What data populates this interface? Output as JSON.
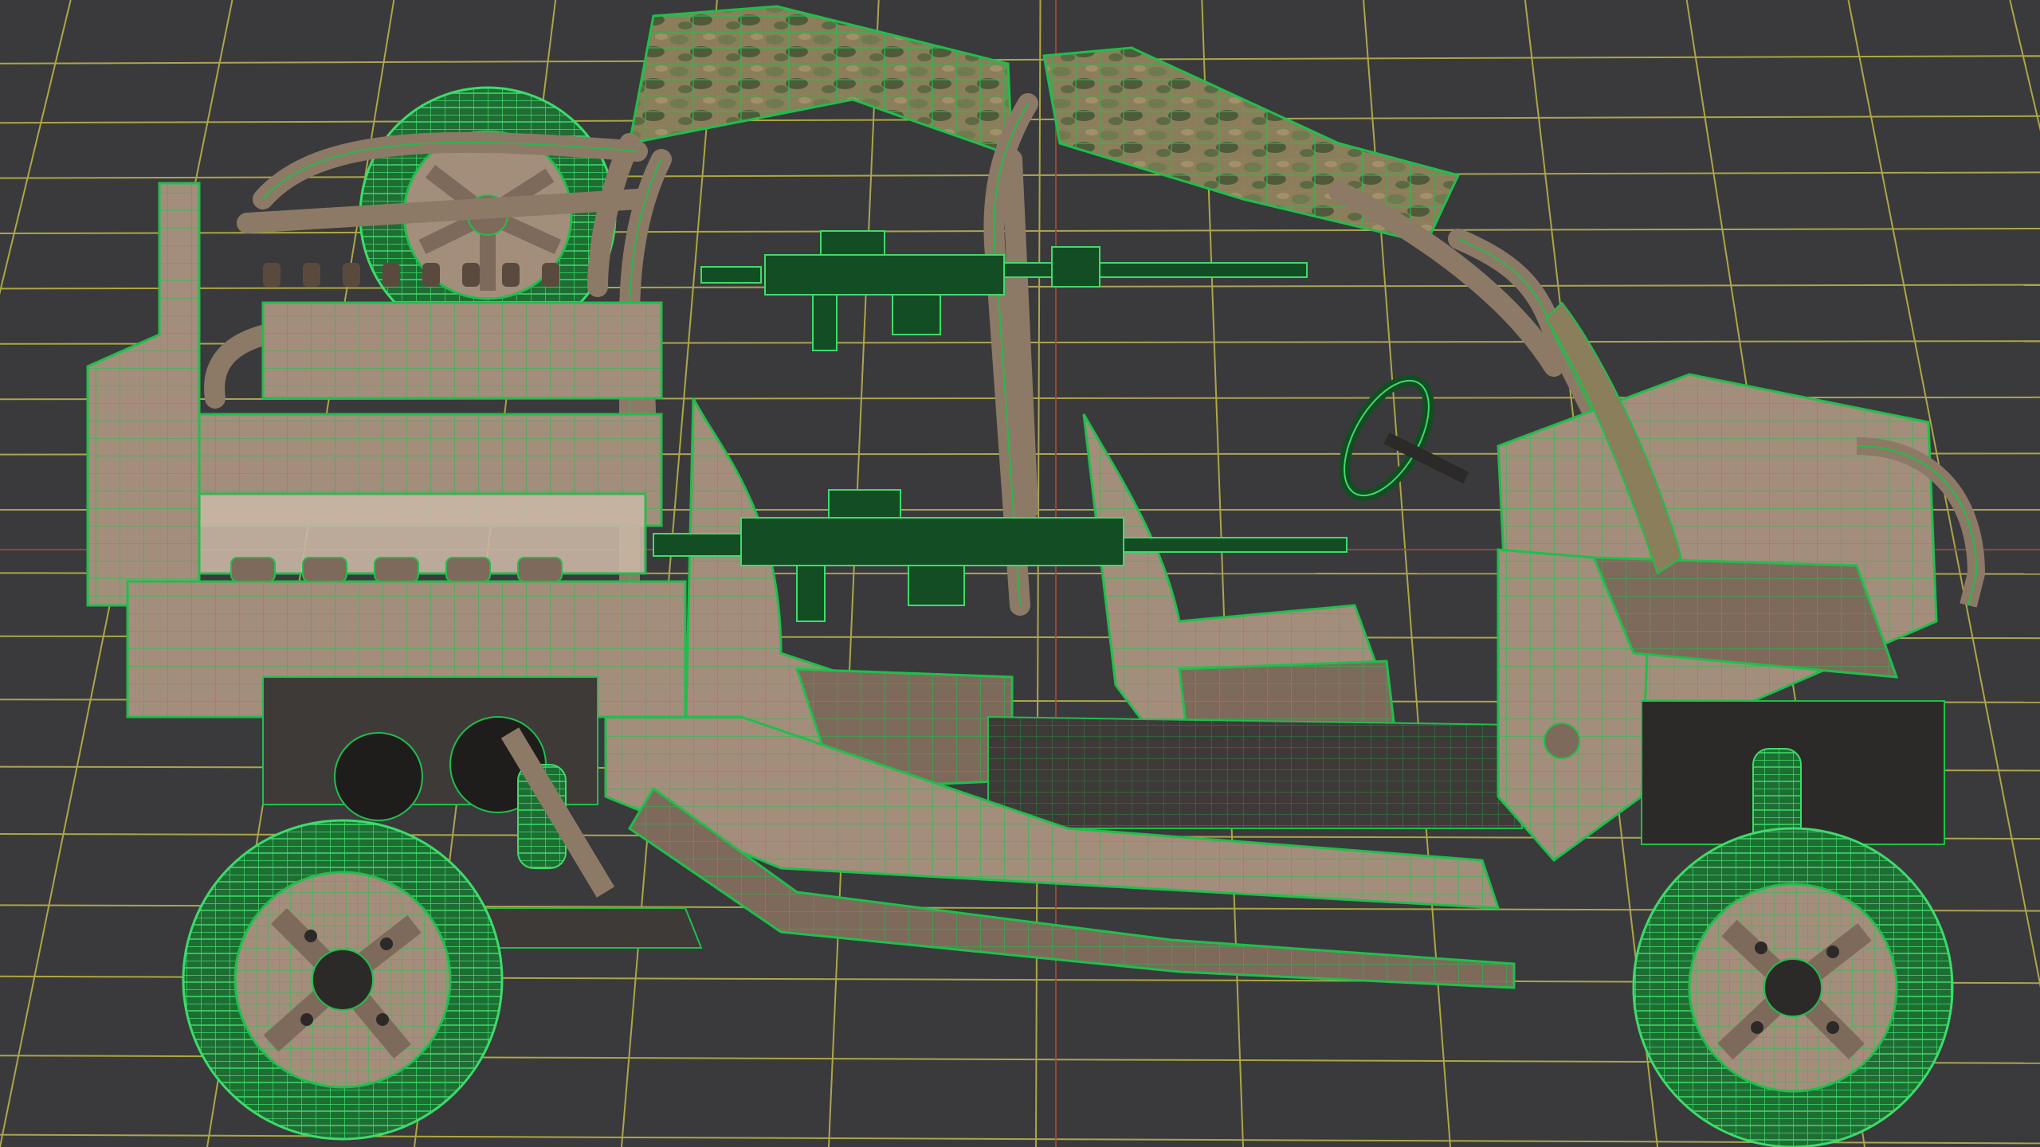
{
  "viewport": {
    "background": "#3a3a3c",
    "grid_color": "#b9b24a",
    "perspective_color": "#9a4a3a"
  },
  "model": {
    "shell_color": "#a38e7c",
    "shell_dark": "#7d6a5a",
    "wire_color": "#1fbf4c",
    "wire_bright": "#3ddc6a",
    "tire_color": "#1e6e34",
    "tire_dark": "#134d23",
    "camo_colors": [
      "#6f7a4f",
      "#8a7f5a",
      "#4f5a3a",
      "#a2906a"
    ],
    "floor_color": "#3e3a38"
  }
}
